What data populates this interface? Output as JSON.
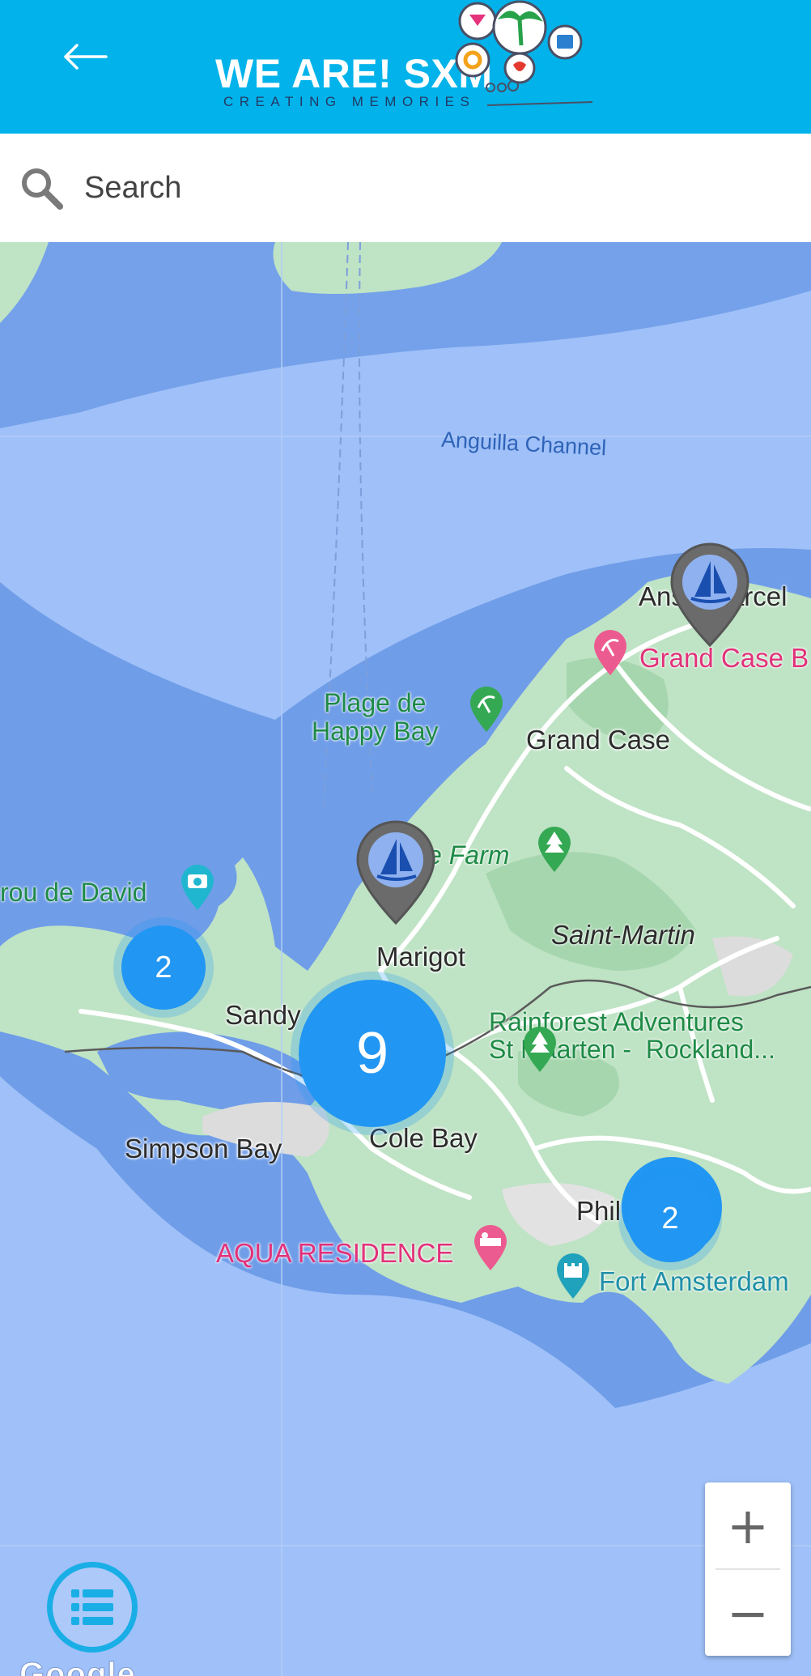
{
  "header": {
    "back_icon": "arrow-left-icon",
    "logo_title": "WE ARE! SXM",
    "logo_subtitle": "CREATING MEMORIES",
    "background_color": "#01b3ea"
  },
  "search": {
    "placeholder": "Search",
    "value": "",
    "icon": "search-icon"
  },
  "map": {
    "labels": {
      "anguilla_channel": "Anguilla Channel",
      "anse_marcel": "Anse Marcel",
      "grand_case_beach": "Grand Case B",
      "plage_happy_bay": "Plage de\nHappy Bay",
      "grand_case": "Grand Case",
      "loterie_farm": "Loterie Farm",
      "trou_de_david": "rou de David",
      "saint_martin": "Saint-Martin",
      "marigot": "Marigot",
      "sandy": "Sandy",
      "rainforest": "Rainforest Adventures\nSt Maarten -  Rockland...",
      "simpson_bay": "Simpson Bay",
      "cole_bay": "Cole Bay",
      "philipsburg": "Phil",
      "aqua_residence": "AQUA RESIDENCE",
      "fort_amsterdam": "Fort Amsterdam"
    },
    "clusters": {
      "west": "2",
      "central": "9",
      "east": "2"
    },
    "marker_icon": "sailboat-icon",
    "cluster_color": "#2196f3",
    "water_color": "#9fc0f8",
    "land_color": "#bfe3c5"
  },
  "controls": {
    "zoom_in": "+",
    "zoom_out": "−",
    "list_icon": "list-icon",
    "attribution": "Google"
  }
}
